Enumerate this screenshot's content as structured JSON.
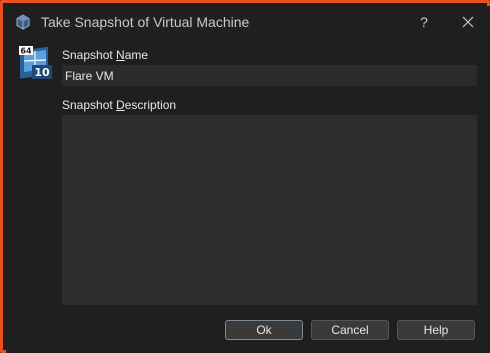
{
  "window": {
    "title": "Take Snapshot of Virtual Machine",
    "help_glyph": "?",
    "close_glyph": "✕",
    "app_icon": "virtualbox-cube-icon"
  },
  "vm_badge": {
    "icon": "vm-os-badge-icon",
    "arch": "64",
    "os_version": "10"
  },
  "snapshot_name": {
    "label_pre": "Snapshot ",
    "label_mnemonic": "N",
    "label_post": "ame",
    "value": "Flare VM"
  },
  "snapshot_description": {
    "label_pre": "Snapshot ",
    "label_mnemonic": "D",
    "label_post": "escription",
    "value": ""
  },
  "buttons": {
    "ok": "Ok",
    "cancel": "Cancel",
    "help": "Help"
  },
  "colors": {
    "accent_border": "#e8501c",
    "background": "#1f1f1f",
    "input_background": "#2b2b2b"
  }
}
